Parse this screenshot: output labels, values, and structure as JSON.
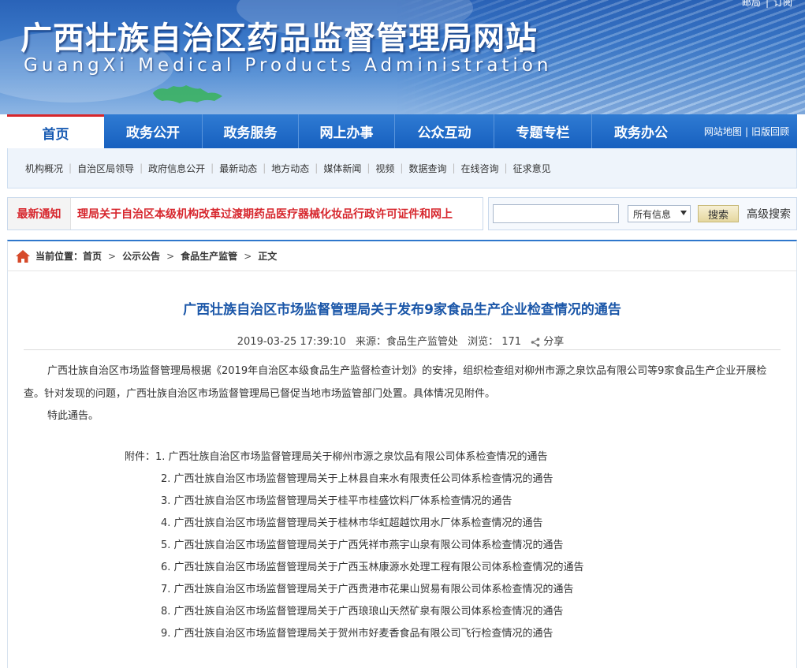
{
  "header": {
    "title_cn": "广西壮族自治区药品监督管理局网站",
    "title_en": "GuangXi  Medical  Products  Administration",
    "top_links": [
      "邮局",
      "订阅"
    ]
  },
  "main_nav": {
    "items": [
      "首页",
      "政务公开",
      "政务服务",
      "网上办事",
      "公众互动",
      "专题专栏",
      "政务办公"
    ],
    "right_links": [
      "网站地图",
      "旧版回顾"
    ]
  },
  "sub_nav": {
    "items": [
      "机构概况",
      "自治区局领导",
      "政府信息公开",
      "最新动态",
      "地方动态",
      "媒体新闻",
      "视频",
      "数据查询",
      "在线咨询",
      "征求意见"
    ]
  },
  "notice": {
    "label": "最新通知",
    "text": "理局关于自治区本级机构改革过渡期药品医疗器械化妆品行政许可证件和网上"
  },
  "search": {
    "placeholder": "",
    "scope": "所有信息",
    "button": "搜索",
    "advanced": "高级搜索"
  },
  "breadcrumb": {
    "label": "当前位置：",
    "items": [
      "首页",
      "公示公告",
      "食品生产监管",
      "正文"
    ]
  },
  "article": {
    "title": "广西壮族自治区市场监督管理局关于发布9家食品生产企业检查情况的通告",
    "date": "2019-03-25 17:39:10",
    "source": "来源：食品生产监管处",
    "views": "浏览：  171",
    "share": "分享",
    "para1": "广西壮族自治区市场监督管理局根据《2019年自治区本级食品生产监督检查计划》的安排，组织检查组对柳州市源之泉饮品有限公司等9家食品生产企业开展检查。针对发现的问题，广西壮族自治区市场监督管理局已督促当地市场监管部门处置。具体情况见附件。",
    "para2": "特此通告。",
    "attach_label": "附件：",
    "attachments": [
      "1. 广西壮族自治区市场监督管理局关于柳州市源之泉饮品有限公司体系检查情况的通告",
      "2. 广西壮族自治区市场监督管理局关于上林县自来水有限责任公司体系检查情况的通告",
      "3. 广西壮族自治区市场监督管理局关于桂平市桂盛饮料厂体系检查情况的通告",
      "4. 广西壮族自治区市场监督管理局关于桂林市华虹超越饮用水厂体系检查情况的通告",
      "5. 广西壮族自治区市场监督管理局关于广西凭祥市燕宇山泉有限公司体系检查情况的通告",
      "6. 广西壮族自治区市场监督管理局关于广西玉林康源水处理工程有限公司体系检查情况的通告",
      "7. 广西壮族自治区市场监督管理局关于广西贵港市花果山贸易有限公司体系检查情况的通告",
      "8. 广西壮族自治区市场监督管理局关于广西琅琅山天然矿泉有限公司体系检查情况的通告",
      "9. 广西壮族自治区市场监督管理局关于贺州市好麦香食品有限公司飞行检查情况的通告"
    ]
  },
  "colors": {
    "nav_blue": "#1760bf",
    "title_blue": "#1a56a8",
    "notice_red": "#d7272e"
  }
}
